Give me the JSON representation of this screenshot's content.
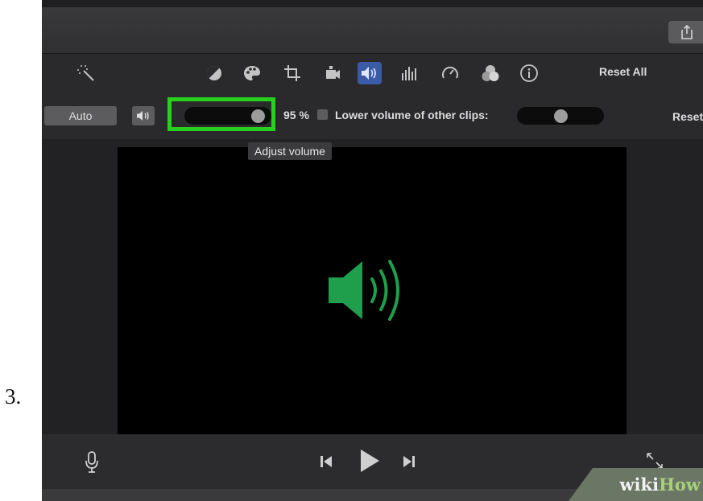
{
  "step": {
    "number": "3."
  },
  "toolbar": {
    "tools": [
      {
        "name": "magic-wand-icon"
      },
      {
        "name": "color-balance-icon"
      },
      {
        "name": "color-palette-icon"
      },
      {
        "name": "crop-icon"
      },
      {
        "name": "stabilization-camera-icon"
      },
      {
        "name": "volume-icon",
        "active": true
      },
      {
        "name": "equalizer-icon"
      },
      {
        "name": "speed-gauge-icon"
      },
      {
        "name": "filter-circles-icon"
      },
      {
        "name": "info-icon"
      }
    ],
    "reset_all_label": "Reset All"
  },
  "volume": {
    "auto_label": "Auto",
    "level": 0.95,
    "percent_text": "95 %",
    "lower_other_label": "Lower volume of other clips:",
    "lower_other_checked": false,
    "lower_other_level": 0.5,
    "reset_label": "Reset",
    "tooltip": "Adjust volume"
  },
  "colors": {
    "highlight": "#26d01c",
    "speaker": "#1f9e4b",
    "active_tool": "#3b5aa8"
  },
  "watermark": {
    "part1": "wiki",
    "part2": "How"
  }
}
